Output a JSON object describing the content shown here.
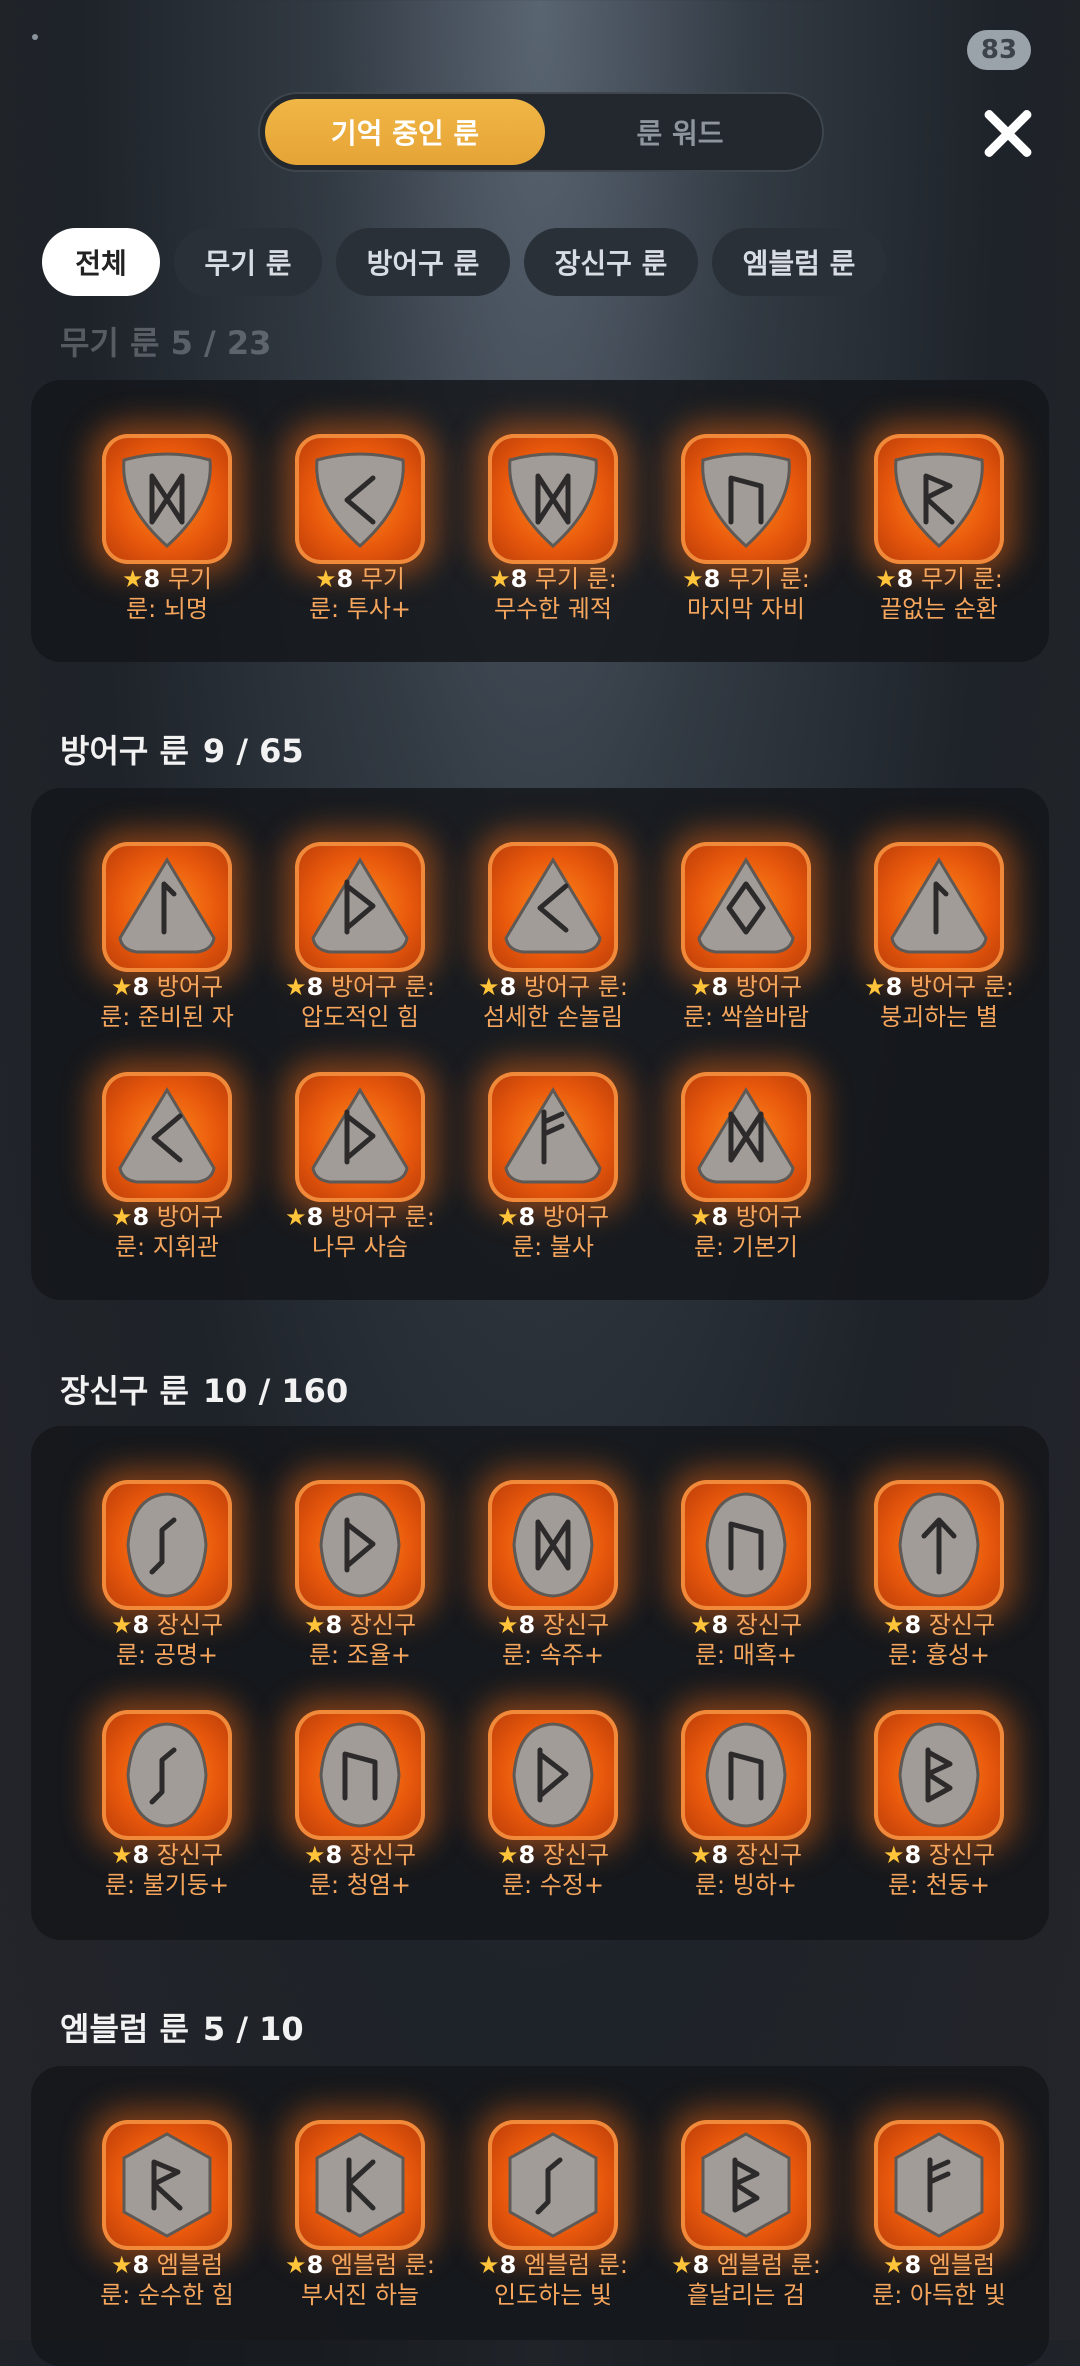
{
  "status": {
    "counter": "83"
  },
  "mode_tabs": {
    "active": "기억 중인 룬",
    "inactive": "룬 워드"
  },
  "filters": [
    "전체",
    "무기 룬",
    "방어구 룬",
    "장신구 룬",
    "엠블럼 룬"
  ],
  "faded_heading": "무기 룬  5 / 23",
  "star": "★",
  "level": "8",
  "sections": [
    {
      "title": "",
      "count": "",
      "items": [
        {
          "l1": " 무기",
          "l2": "룬: 뇌명",
          "shape": "shield",
          "rune": "M"
        },
        {
          "l1": " 무기",
          "l2": "룬: 투사+",
          "shape": "shield",
          "rune": "<"
        },
        {
          "l1": " 무기 룬:",
          "l2": "무수한 궤적",
          "shape": "shield",
          "rune": "M"
        },
        {
          "l1": " 무기 룬:",
          "l2": "마지막 자비",
          "shape": "shield",
          "rune": "N"
        },
        {
          "l1": " 무기 룬:",
          "l2": "끝없는 순환",
          "shape": "shield",
          "rune": "R"
        }
      ]
    },
    {
      "title": "방어구 룬",
      "count": "9 / 65",
      "items": [
        {
          "l1": " 방어구",
          "l2": "룬: 준비된 자",
          "shape": "tri",
          "rune": "I"
        },
        {
          "l1": " 방어구 룬:",
          "l2": "압도적인 힘",
          "shape": "tri",
          "rune": "D"
        },
        {
          "l1": " 방어구 룬:",
          "l2": "섬세한 손놀림",
          "shape": "tri",
          "rune": "<"
        },
        {
          "l1": " 방어구",
          "l2": "룬: 싹쓸바람",
          "shape": "tri",
          "rune": "O"
        },
        {
          "l1": " 방어구 룬:",
          "l2": "붕괴하는 별",
          "shape": "tri",
          "rune": "I"
        },
        {
          "l1": " 방어구",
          "l2": "룬: 지휘관",
          "shape": "tri",
          "rune": "<"
        },
        {
          "l1": " 방어구 룬:",
          "l2": "나무 사슴",
          "shape": "tri",
          "rune": "D"
        },
        {
          "l1": " 방어구",
          "l2": "룬: 불사",
          "shape": "tri",
          "rune": "F"
        },
        {
          "l1": " 방어구",
          "l2": "룬: 기본기",
          "shape": "tri",
          "rune": "M"
        }
      ]
    },
    {
      "title": "장신구 룬",
      "count": "10 / 160",
      "items": [
        {
          "l1": " 장신구",
          "l2": "룬: 공명+",
          "shape": "oval",
          "rune": "S"
        },
        {
          "l1": " 장신구",
          "l2": "룬: 조율+",
          "shape": "oval",
          "rune": "D"
        },
        {
          "l1": " 장신구",
          "l2": "룬: 속주+",
          "shape": "oval",
          "rune": "M"
        },
        {
          "l1": " 장신구",
          "l2": "룬: 매혹+",
          "shape": "oval",
          "rune": "N"
        },
        {
          "l1": " 장신구",
          "l2": "룬: 흉성+",
          "shape": "oval",
          "rune": "T"
        },
        {
          "l1": " 장신구",
          "l2": "룬: 불기둥+",
          "shape": "oval",
          "rune": "S"
        },
        {
          "l1": " 장신구",
          "l2": "룬: 청염+",
          "shape": "oval",
          "rune": "N"
        },
        {
          "l1": " 장신구",
          "l2": "룬: 수정+",
          "shape": "oval",
          "rune": "D"
        },
        {
          "l1": " 장신구",
          "l2": "룬: 빙하+",
          "shape": "oval",
          "rune": "N"
        },
        {
          "l1": " 장신구",
          "l2": "룬: 천둥+",
          "shape": "oval",
          "rune": "B"
        }
      ]
    },
    {
      "title": "엠블럼 룬",
      "count": "5 / 10",
      "items": [
        {
          "l1": " 엠블럼",
          "l2": "룬: 순수한 힘",
          "shape": "hex",
          "rune": "R"
        },
        {
          "l1": " 엠블럼 룬:",
          "l2": "부서진 하늘",
          "shape": "hex",
          "rune": "K"
        },
        {
          "l1": " 엠블럼 룬:",
          "l2": "인도하는 빛",
          "shape": "hex",
          "rune": "S"
        },
        {
          "l1": " 엠블럼 룬:",
          "l2": "흩날리는 검",
          "shape": "hex",
          "rune": "B"
        },
        {
          "l1": " 엠블럼",
          "l2": "룬: 아득한 빛",
          "shape": "hex",
          "rune": "F"
        }
      ]
    }
  ]
}
